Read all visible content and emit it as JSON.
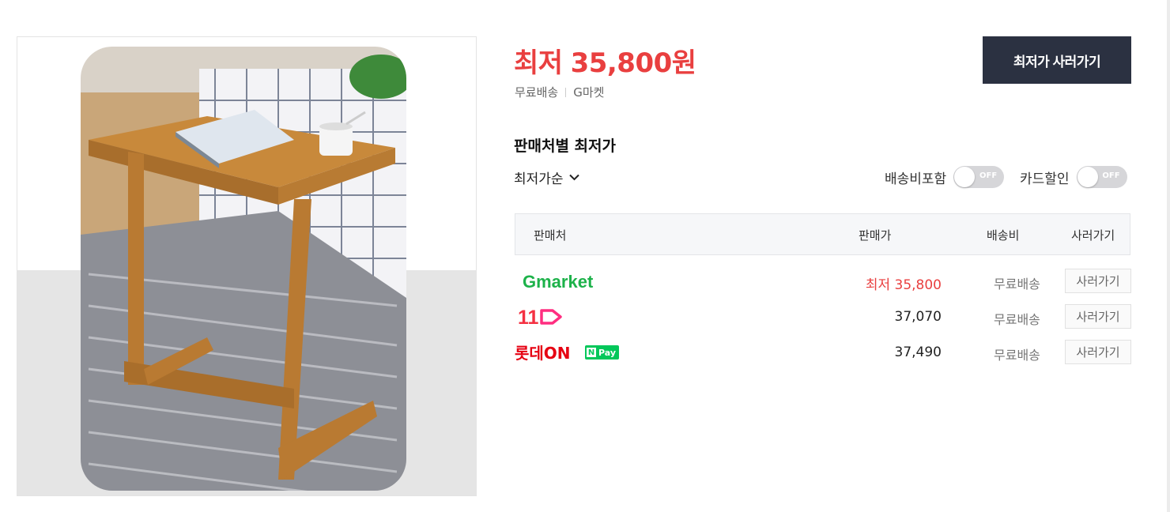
{
  "price": {
    "prefix": "최저",
    "amount": "35,800원",
    "shipping": "무료배송",
    "store": "G마켓",
    "buy_label": "최저가 사러가기"
  },
  "section": {
    "title": "판매처별 최저가",
    "sort_label": "최저가순",
    "toggle_shipping_label": "배송비포함",
    "toggle_card_label": "카드할인",
    "toggle_state": "OFF"
  },
  "table": {
    "headers": {
      "seller": "판매처",
      "price": "판매가",
      "shipping": "배송비",
      "buy": "사러가기"
    },
    "rows": [
      {
        "seller_logo": "Gmarket",
        "price": "최저 35,800",
        "lowest": true,
        "shipping": "무료배송",
        "buy": "사러가기"
      },
      {
        "seller_logo": "11",
        "price": "37,070",
        "lowest": false,
        "shipping": "무료배송",
        "buy": "사러가기"
      },
      {
        "seller_logo": "롯데ON",
        "badge": "Pay",
        "badge_letter": "N",
        "price": "37,490",
        "lowest": false,
        "shipping": "무료배송",
        "buy": "사러가기"
      }
    ]
  },
  "colors": {
    "accent_red": "#e93f3f",
    "button_dark": "#2b3141",
    "npay_green": "#03c75a"
  }
}
